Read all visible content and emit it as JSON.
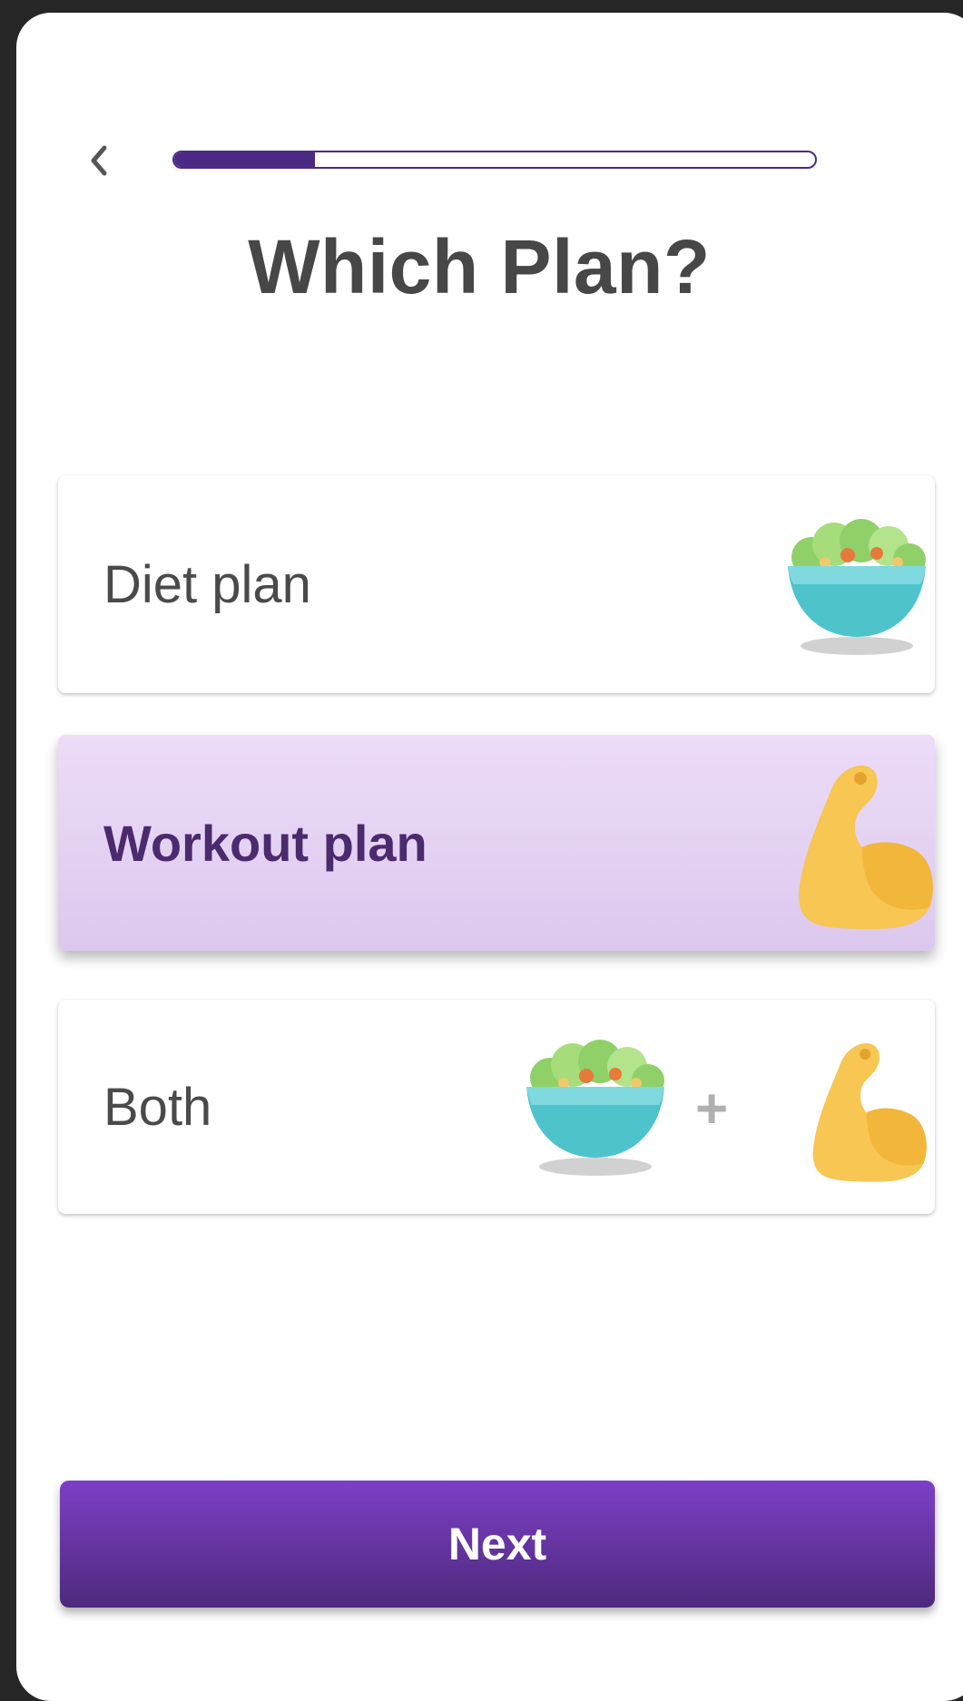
{
  "progress": {
    "value": 0.22
  },
  "header": {
    "title": "Which Plan?"
  },
  "options": [
    {
      "label": "Diet plan",
      "icons": [
        "salad-bowl-icon"
      ],
      "selected": false
    },
    {
      "label": "Workout plan",
      "icons": [
        "flexed-biceps-icon"
      ],
      "selected": true
    },
    {
      "label": "Both",
      "icons": [
        "salad-bowl-icon",
        "plus-icon",
        "flexed-biceps-icon"
      ],
      "selected": false
    }
  ],
  "both_plus": "+",
  "footer": {
    "next_label": "Next"
  },
  "colors": {
    "accent": "#4b2a84",
    "selected_bg": "#e6d4f5",
    "button_top": "#7d3fc6",
    "button_bottom": "#4d2a7c"
  }
}
